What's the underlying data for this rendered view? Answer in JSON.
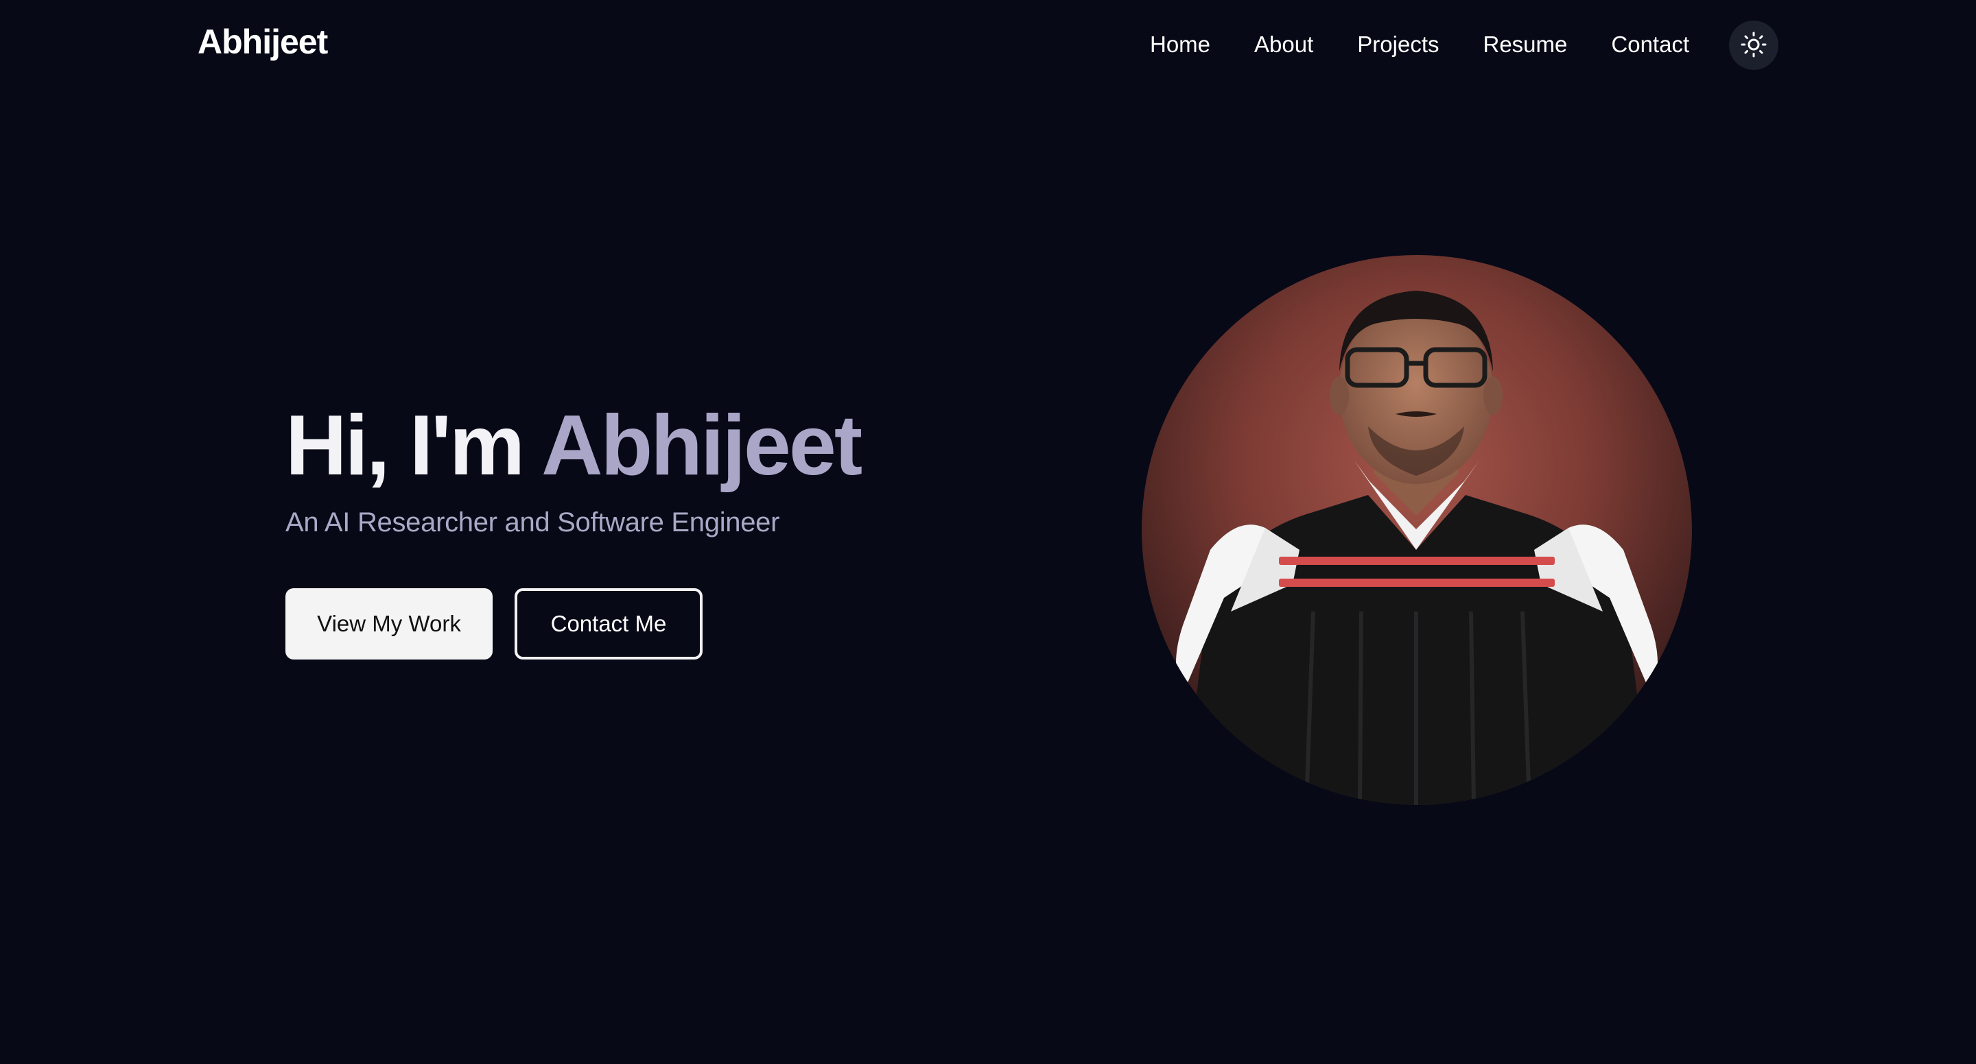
{
  "navbar": {
    "brand": "Abhijeet",
    "links": [
      {
        "label": "Home"
      },
      {
        "label": "About"
      },
      {
        "label": "Projects"
      },
      {
        "label": "Resume"
      },
      {
        "label": "Contact"
      }
    ],
    "theme_toggle_icon": "sun-icon"
  },
  "hero": {
    "greeting": "Hi, I'm",
    "name": "Abhijeet",
    "subtitle": "An AI Researcher and Software Engineer",
    "primary_button": "View My Work",
    "secondary_button": "Contact Me"
  },
  "portrait": {
    "icon": "profile-photo"
  },
  "colors": {
    "background": "#070916",
    "accent_name": "#a9a6c8",
    "subtitle": "#a9a9c7",
    "button_light": "#f4f4f5"
  }
}
